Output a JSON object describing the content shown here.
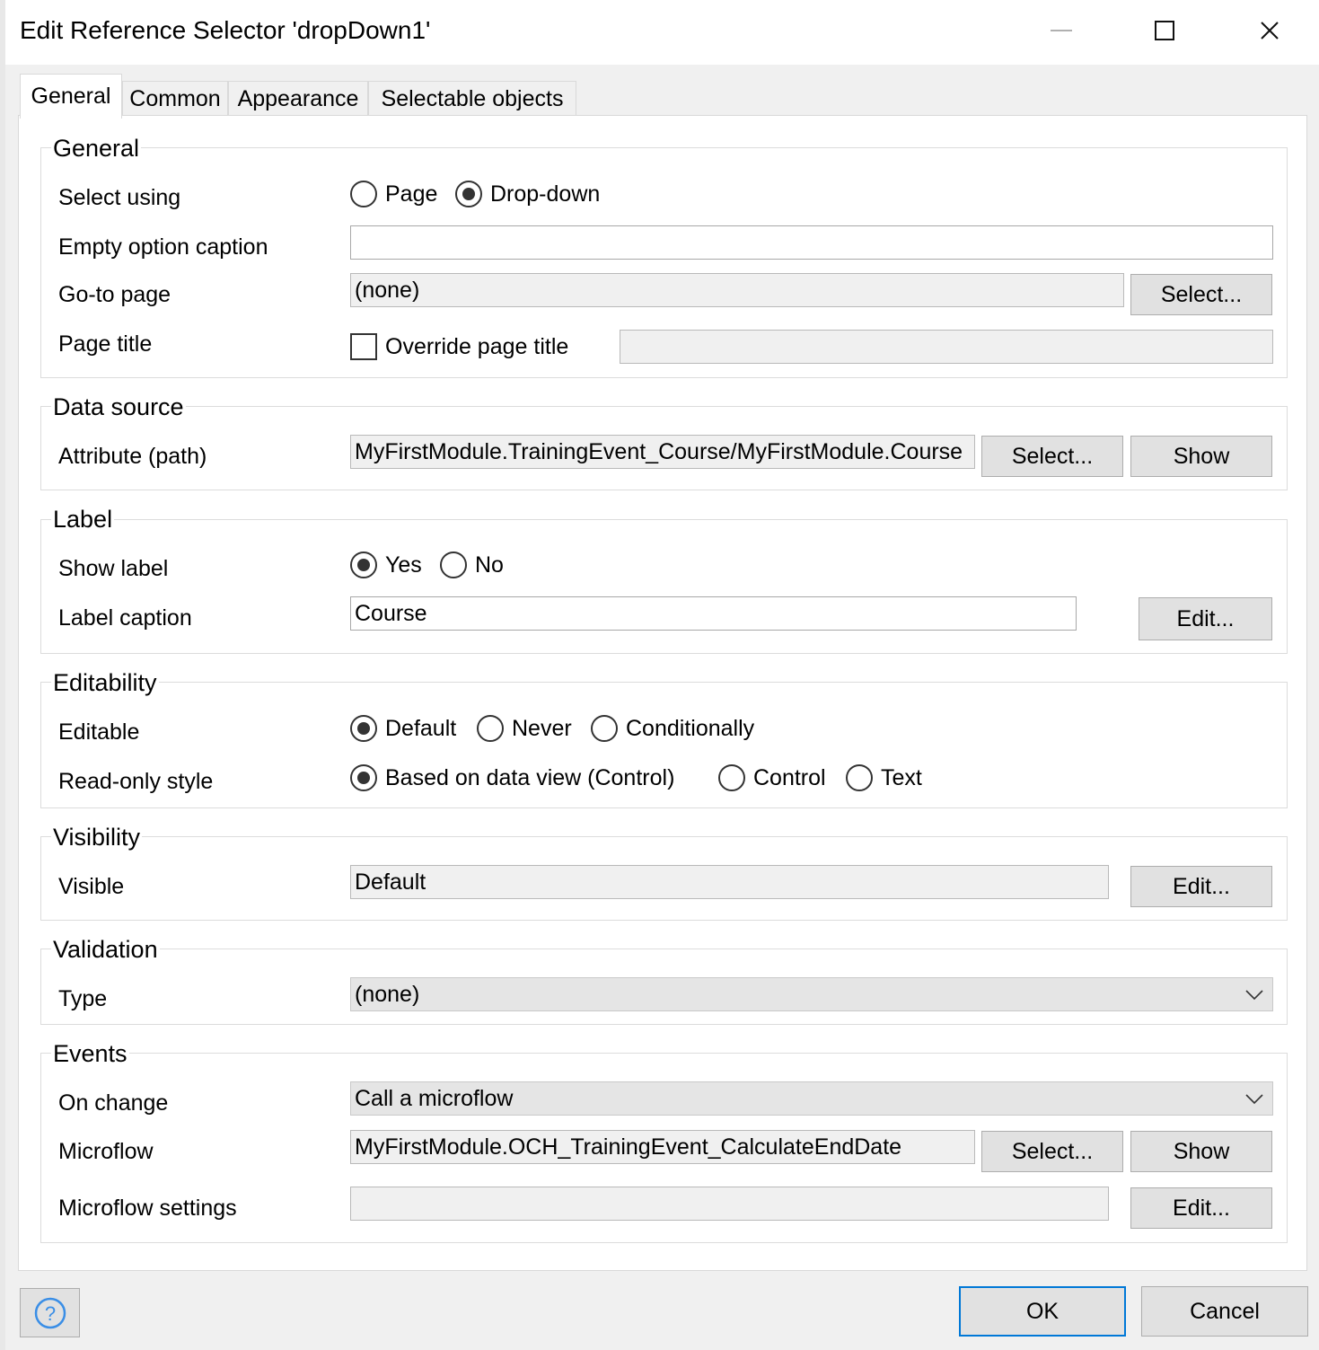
{
  "window": {
    "title": "Edit Reference Selector 'dropDown1'",
    "minimize_icon": "minimize-icon",
    "maximize_icon": "maximize-icon",
    "close_icon": "close-icon"
  },
  "tabs": [
    {
      "label": "General",
      "active": true
    },
    {
      "label": "Common",
      "active": false
    },
    {
      "label": "Appearance",
      "active": false
    },
    {
      "label": "Selectable objects",
      "active": false
    }
  ],
  "general": {
    "title": "General",
    "select_using_label": "Select using",
    "select_using_options": [
      "Page",
      "Drop-down"
    ],
    "select_using_selected": "Drop-down",
    "empty_option_caption_label": "Empty option caption",
    "empty_option_caption_value": "",
    "goto_page_label": "Go-to page",
    "goto_page_value": "(none)",
    "goto_page_select": "Select...",
    "page_title_label": "Page title",
    "override_page_title": "Override page title",
    "override_checked": false,
    "page_title_value": ""
  },
  "data_source": {
    "title": "Data source",
    "attribute_label": "Attribute (path)",
    "attribute_value": "MyFirstModule.TrainingEvent_Course/MyFirstModule.Course",
    "select_button": "Select...",
    "show_button": "Show"
  },
  "label": {
    "title": "Label",
    "show_label_label": "Show label",
    "show_label_options": [
      "Yes",
      "No"
    ],
    "show_label_selected": "Yes",
    "caption_label": "Label caption",
    "caption_value": "Course",
    "edit_button": "Edit..."
  },
  "editability": {
    "title": "Editability",
    "editable_label": "Editable",
    "editable_options": [
      "Default",
      "Never",
      "Conditionally"
    ],
    "editable_selected": "Default",
    "readonly_style_label": "Read-only style",
    "readonly_style_options": [
      "Based on data view (Control)",
      "Control",
      "Text"
    ],
    "readonly_style_selected": "Based on data view (Control)"
  },
  "visibility": {
    "title": "Visibility",
    "visible_label": "Visible",
    "visible_value": "Default",
    "edit_button": "Edit..."
  },
  "validation": {
    "title": "Validation",
    "type_label": "Type",
    "type_value": "(none)"
  },
  "events": {
    "title": "Events",
    "on_change_label": "On change",
    "on_change_value": "Call a microflow",
    "microflow_label": "Microflow",
    "microflow_value": "MyFirstModule.OCH_TrainingEvent_CalculateEndDate",
    "select_button": "Select...",
    "show_button": "Show",
    "settings_label": "Microflow settings",
    "settings_value": "",
    "edit_button": "Edit..."
  },
  "footer": {
    "help_icon": "help-icon",
    "ok_button": "OK",
    "cancel_button": "Cancel"
  }
}
